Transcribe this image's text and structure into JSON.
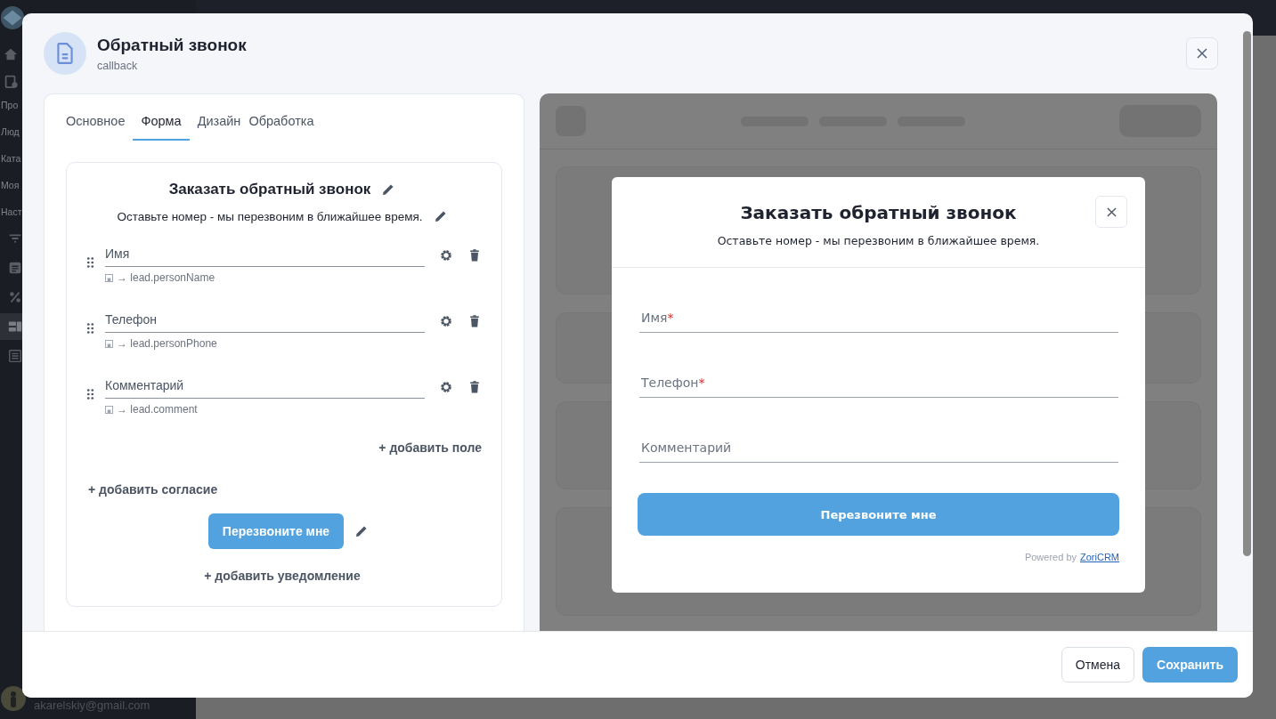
{
  "background": {
    "sidebar_items": [
      {
        "label": "Про"
      },
      {
        "label": "Люд"
      },
      {
        "label": "Ката"
      },
      {
        "label": "Моя"
      },
      {
        "label": "Наст"
      }
    ],
    "sidebar_icons": [
      {
        "kind": "filter",
        "selected": false
      },
      {
        "kind": "document",
        "selected": false
      },
      {
        "kind": "percent",
        "selected": false
      },
      {
        "kind": "widgets",
        "selected": true
      },
      {
        "kind": "list",
        "selected": false
      }
    ],
    "user_email": "akarelskiy@gmail.com"
  },
  "modal": {
    "title": "Обратный звонок",
    "subtitle": "callback",
    "tabs": [
      {
        "label": "Основное",
        "selected": false
      },
      {
        "label": "Форма",
        "selected": true
      },
      {
        "label": "Дизайн",
        "selected": false
      },
      {
        "label": "Обработка",
        "selected": false
      }
    ],
    "form_editor": {
      "title": "Заказать обратный звонок",
      "subtitle": "Оставьте номер - мы перезвоним в ближайшее время.",
      "fields": [
        {
          "label": "Имя",
          "binding": "→ lead.personName"
        },
        {
          "label": "Телефон",
          "binding": "→ lead.personPhone"
        },
        {
          "label": "Комментарий",
          "binding": "→ lead.comment"
        }
      ],
      "add_field": "+ добавить поле",
      "add_consent": "+ добавить согласие",
      "submit_button": "Перезвоните мне",
      "add_notification": "+ добавить уведомление"
    },
    "preview": {
      "title": "Заказать обратный звонок",
      "subtitle": "Оставьте номер - мы перезвоним в ближайшее время.",
      "fields": [
        {
          "label": "Имя",
          "required_mark": "*"
        },
        {
          "label": "Телефон",
          "required_mark": "*"
        },
        {
          "label": "Комментарий"
        }
      ],
      "submit_button": "Перезвоните мне",
      "powered_by": "Powered by",
      "brand_link": "ZoriCRM"
    },
    "buttons": {
      "cancel": "Отмена",
      "save": "Сохранить"
    }
  }
}
